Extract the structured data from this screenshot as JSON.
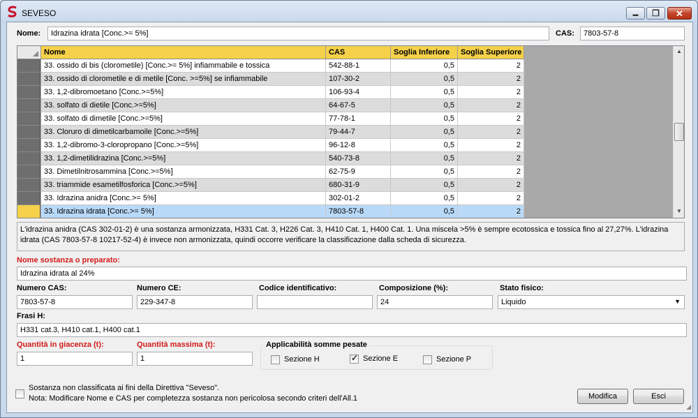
{
  "window": {
    "title": "SEVESO",
    "min_glyph": "▬",
    "max_glyph": "❐",
    "close_glyph": "✕"
  },
  "top": {
    "nome_label": "Nome:",
    "nome_value": "Idrazina idrata [Conc.>= 5%]",
    "cas_label": "CAS:",
    "cas_value": "7803-57-8"
  },
  "grid": {
    "columns": [
      "Nome",
      "CAS",
      "Soglia Inferiore",
      "Soglia Superiore"
    ],
    "rows": [
      {
        "nome": "33. ossido di bis (clorometile) [Conc.>= 5%] infiammabile e tossica",
        "cas": "542-88-1",
        "inf": "0,5",
        "sup": "2"
      },
      {
        "nome": "33. ossido di clorometile e di metile [Conc. >=5%] se infiammabile",
        "cas": "107-30-2",
        "inf": "0,5",
        "sup": "2"
      },
      {
        "nome": "33. 1,2-dibromoetano [Conc.>=5%]",
        "cas": "106-93-4",
        "inf": "0,5",
        "sup": "2"
      },
      {
        "nome": "33. solfato di dietile [Conc.>=5%]",
        "cas": "64-67-5",
        "inf": "0,5",
        "sup": "2"
      },
      {
        "nome": "33. solfato di dimetile [Conc.>=5%]",
        "cas": "77-78-1",
        "inf": "0,5",
        "sup": "2"
      },
      {
        "nome": "33. Cloruro di dimetilcarbamoile [Conc.>=5%]",
        "cas": "79-44-7",
        "inf": "0,5",
        "sup": "2"
      },
      {
        "nome": "33. 1,2-dibromo-3-cloropropano [Conc.>=5%]",
        "cas": "96-12-8",
        "inf": "0,5",
        "sup": "2"
      },
      {
        "nome": "33. 1,2-dimetilidrazina [Conc.>=5%]",
        "cas": "540-73-8",
        "inf": "0,5",
        "sup": "2"
      },
      {
        "nome": "33. Dimetilnitrosammina [Conc.>=5%]",
        "cas": "62-75-9",
        "inf": "0,5",
        "sup": "2"
      },
      {
        "nome": "33. triammide esametilfosforica [Conc.>=5%]",
        "cas": "680-31-9",
        "inf": "0,5",
        "sup": "2"
      },
      {
        "nome": "33. Idrazina anidra [Conc.>= 5%]",
        "cas": "302-01-2",
        "inf": "0,5",
        "sup": "2"
      },
      {
        "nome": "33. Idrazina idrata [Conc.>= 5%]",
        "cas": "7803-57-8",
        "inf": "0,5",
        "sup": "2"
      }
    ],
    "selected_index": 11,
    "header_color": "#f5d14a",
    "selected_row_color": "#b9d9f8"
  },
  "description": "L'idrazina anidra (CAS 302-01-2) è una sostanza armonizzata, H331 Cat. 3, H226 Cat. 3, H410 Cat. 1, H400 Cat. 1. Una miscela >5% è sempre ecotossica e tossica fino al 27,27%. L'idrazina idrata (CAS 7803-57-8 10217-52-4) è invece non armonizzata, quindi occorre verificare la classificazione dalla scheda di sicurezza.",
  "form": {
    "nome_sostanza_label": "Nome sostanza o preparato:",
    "nome_sostanza_value": "Idrazina idrata al 24%",
    "numero_cas_label": "Numero CAS:",
    "numero_cas_value": "7803-57-8",
    "numero_ce_label": "Numero CE:",
    "numero_ce_value": "229-347-8",
    "codice_label": "Codice identificativo:",
    "codice_value": "",
    "composizione_label": "Composizione (%):",
    "composizione_value": "24",
    "stato_label": "Stato fisico:",
    "stato_value": "Liquido",
    "frasi_label": "Frasi H:",
    "frasi_value": "H331 cat.3, H410 cat.1, H400 cat.1",
    "giacenza_label": "Quantità in giacenza (t):",
    "giacenza_value": "1",
    "massima_label": "Quantità massima (t):",
    "massima_value": "1",
    "applicabilita_label": "Applicabilità somme pesate",
    "sezione_h_label": "Sezione H",
    "sezione_e_label": "Sezione E",
    "sezione_p_label": "Sezione P",
    "sezione_h_checked": false,
    "sezione_e_checked": true,
    "sezione_p_checked": false,
    "non_classificata_label": "Sostanza non classificata ai fini della Direttiva \"Seveso\".",
    "nota_label": "Nota: Modificare Nome e CAS per completezza sostanza non pericolosa secondo criteri dell'All.1",
    "modifica_label": "Modifica",
    "esci_label": "Esci"
  }
}
